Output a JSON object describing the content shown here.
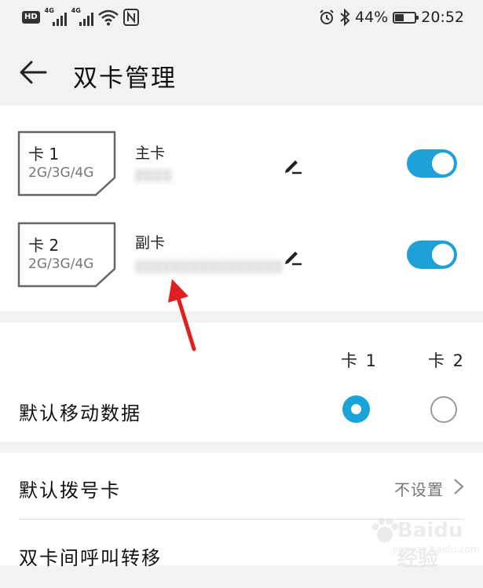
{
  "status_bar": {
    "hd_label": "HD",
    "network1": "4G",
    "network2": "4G",
    "battery_percent": "44%",
    "battery_level": 0.44,
    "time": "20:52",
    "icons": [
      "hd-icon",
      "signal-icon",
      "signal-icon",
      "wifi-icon",
      "nfc-icon",
      "alarm-icon",
      "bluetooth-icon",
      "battery-icon"
    ]
  },
  "header": {
    "title": "双卡管理"
  },
  "sim_cards": [
    {
      "name": "卡 1",
      "network": "2G/3G/4G",
      "role": "主卡",
      "enabled": true
    },
    {
      "name": "卡 2",
      "network": "2G/3G/4G",
      "role": "副卡",
      "enabled": true
    }
  ],
  "default_data": {
    "label": "默认移动数据",
    "columns": [
      "卡 1",
      "卡 2"
    ],
    "selected": 0
  },
  "settings": [
    {
      "label": "默认拨号卡",
      "value": "不设置"
    },
    {
      "label": "双卡间呼叫转移"
    }
  ],
  "colors": {
    "accent": "#1da1d6",
    "annotation": "#e02020",
    "background": "#f2f2f2"
  },
  "watermark": {
    "brand": "Baidu 经验",
    "url": "jingyan.baidu.com"
  }
}
